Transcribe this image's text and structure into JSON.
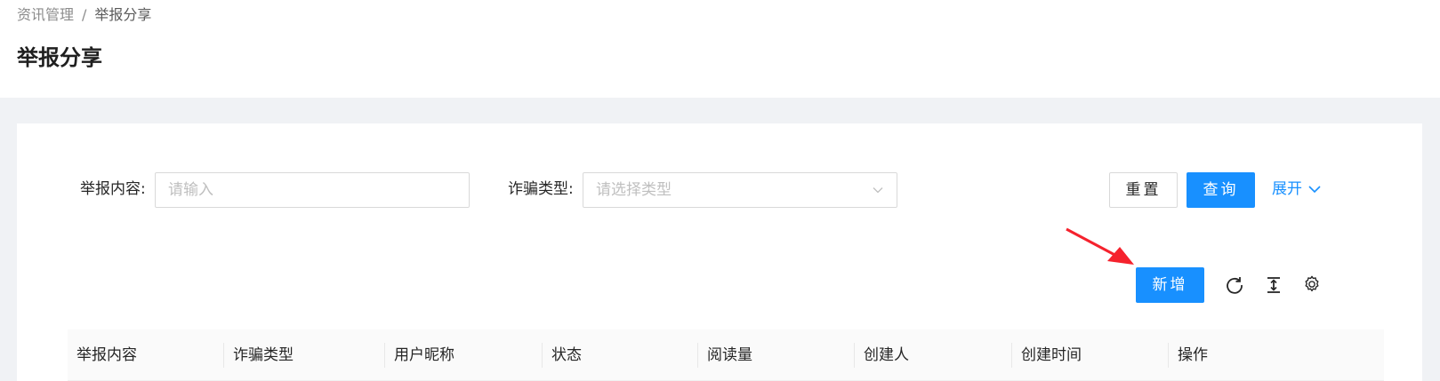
{
  "breadcrumb": {
    "parent": "资讯管理",
    "separator": "/",
    "current": "举报分享"
  },
  "page": {
    "title": "举报分享"
  },
  "search_form": {
    "content_label": "举报内容:",
    "content_placeholder": "请输入",
    "type_label": "诈骗类型:",
    "type_placeholder": "请选择类型",
    "reset_label": "重置",
    "query_label": "查询",
    "expand_label": "展开"
  },
  "toolbar": {
    "add_label": "新增",
    "icons": [
      "reload-icon",
      "column-height-icon",
      "setting-icon"
    ]
  },
  "table": {
    "columns": [
      "举报内容",
      "诈骗类型",
      "用户昵称",
      "状态",
      "阅读量",
      "创建人",
      "创建时间",
      "操作"
    ]
  },
  "colors": {
    "primary": "#1890ff",
    "annotation_arrow": "#f5222d",
    "background": "#f0f2f5"
  }
}
